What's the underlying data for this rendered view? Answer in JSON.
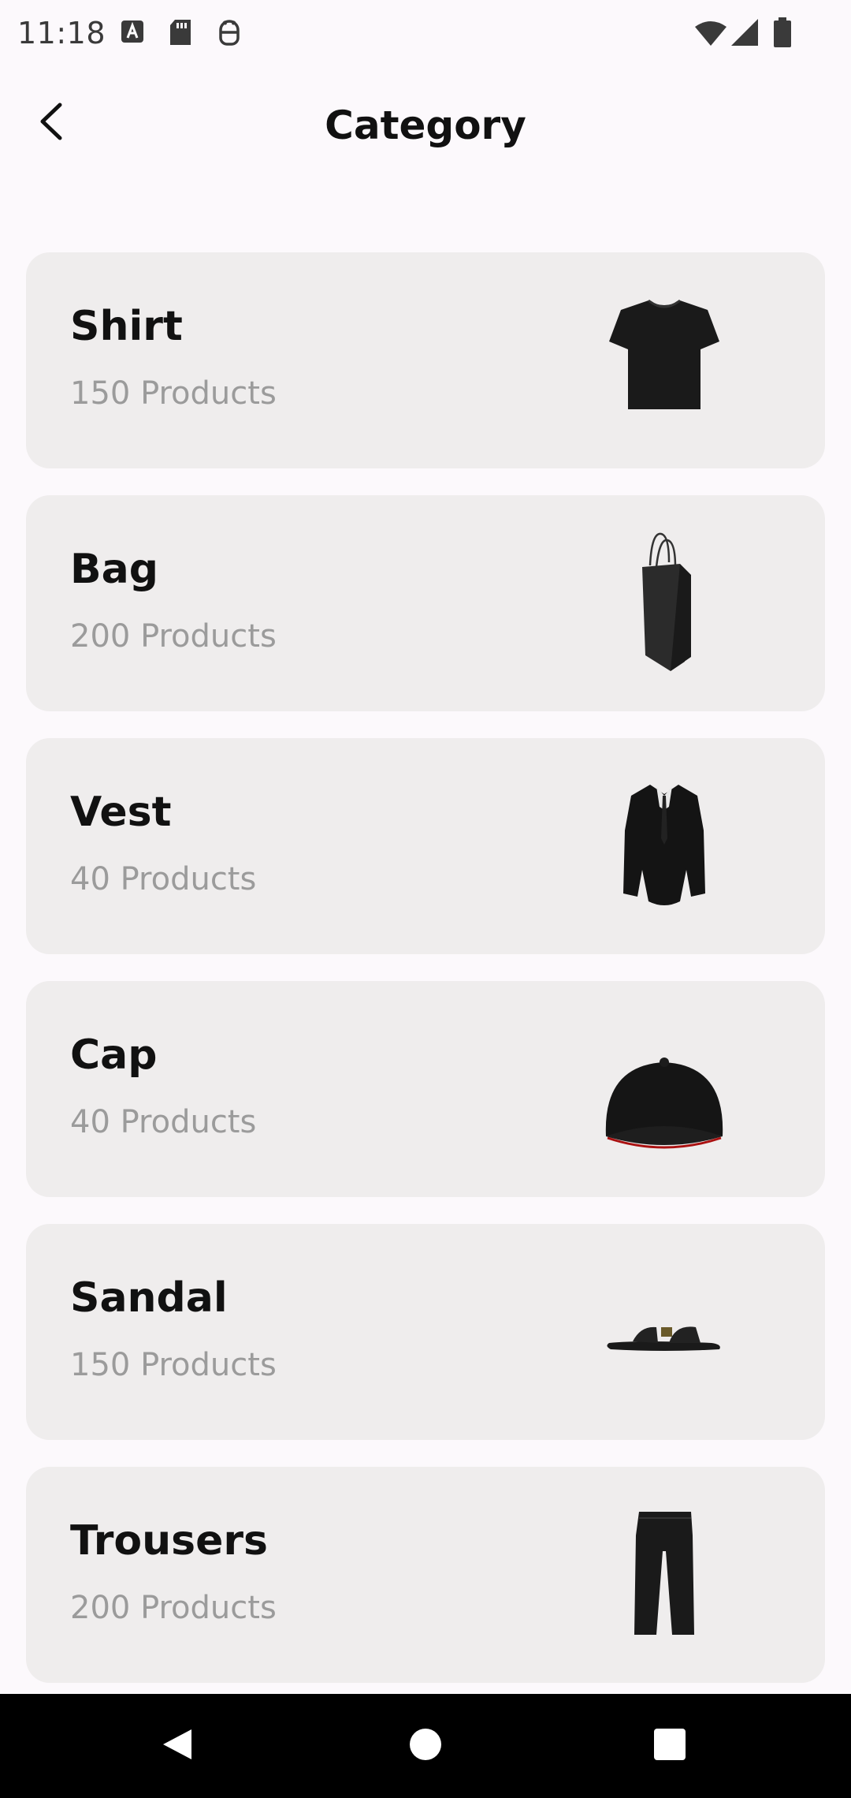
{
  "status_bar": {
    "time": "11:18",
    "icons": [
      "a-notification-icon",
      "sd-card-icon",
      "android-debug-icon",
      "wifi-icon",
      "signal-icon",
      "battery-icon"
    ]
  },
  "header": {
    "title": "Category",
    "back_icon": "back-arrow-icon"
  },
  "categories": [
    {
      "name": "Shirt",
      "count": "150 Products",
      "image": "shirt-image"
    },
    {
      "name": "Bag",
      "count": "200 Products",
      "image": "bag-image"
    },
    {
      "name": "Vest",
      "count": "40 Products",
      "image": "vest-image"
    },
    {
      "name": "Cap",
      "count": "40 Products",
      "image": "cap-image"
    },
    {
      "name": "Sandal",
      "count": "150 Products",
      "image": "sandal-image"
    },
    {
      "name": "Trousers",
      "count": "200 Products",
      "image": "trousers-image"
    }
  ],
  "nav_bar": {
    "icons": [
      "nav-back-icon",
      "nav-home-icon",
      "nav-recents-icon"
    ]
  },
  "colors": {
    "background": "#fcf9fc",
    "card": "#efeded",
    "title_text": "#111111",
    "count_text": "#9b9b9b",
    "nav_bar": "#000000"
  }
}
